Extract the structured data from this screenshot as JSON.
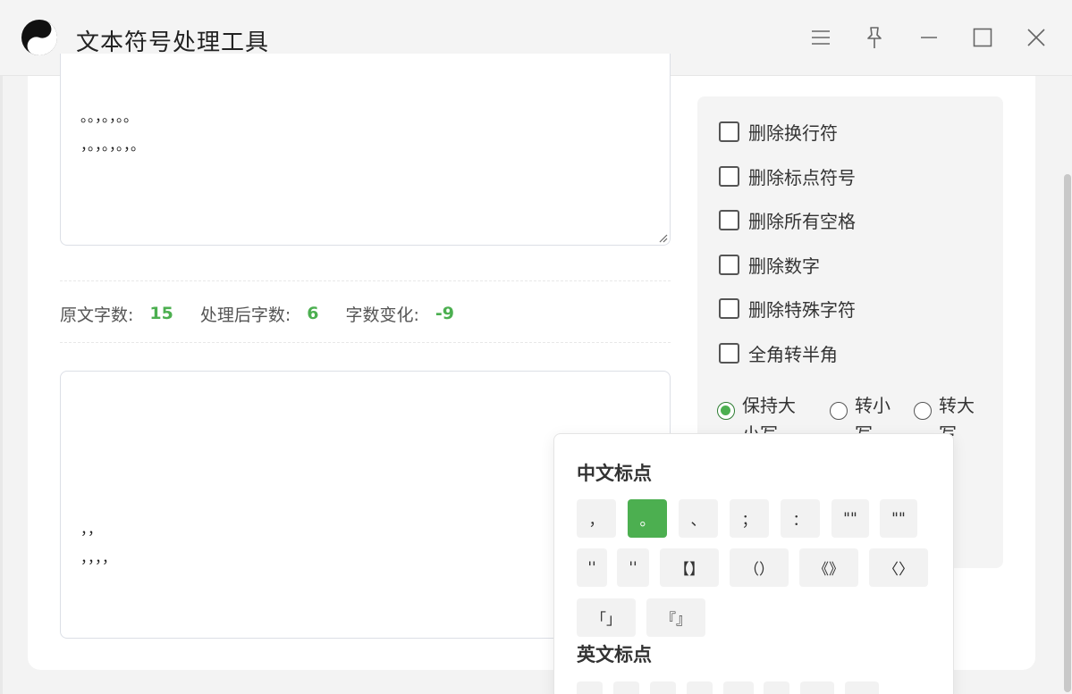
{
  "app": {
    "title": "文本符号处理工具"
  },
  "window_controls": [
    "menu-icon",
    "pin-icon",
    "minimize-icon",
    "maximize-icon",
    "close-icon"
  ],
  "input": {
    "lines": [
      "。。，。，。。",
      "，。，。，。，。"
    ]
  },
  "stats": {
    "original_label": "原文字数:",
    "original_value": "15",
    "processed_label": "处理后字数:",
    "processed_value": "6",
    "change_label": "字数变化:",
    "change_value": "-9"
  },
  "output": {
    "lines": [
      "，，",
      "，，，，"
    ]
  },
  "options": {
    "checkboxes": [
      {
        "label": "删除换行符",
        "checked": false
      },
      {
        "label": "删除标点符号",
        "checked": false
      },
      {
        "label": "删除所有空格",
        "checked": false
      },
      {
        "label": "删除数字",
        "checked": false
      },
      {
        "label": "删除特殊字符",
        "checked": false
      },
      {
        "label": "全角转半角",
        "checked": false
      }
    ],
    "case_radios": [
      {
        "label": "保持大小写",
        "checked": true
      },
      {
        "label": "转小写",
        "checked": false
      },
      {
        "label": "转大写",
        "checked": false
      }
    ]
  },
  "popover": {
    "chinese_heading": "中文标点",
    "chinese_chips": [
      "，",
      "。",
      "、",
      "；",
      "：",
      "\"\"",
      "\"\"",
      "''",
      "''",
      "【】",
      "（）",
      "《》",
      "〈〉",
      "「」",
      "『』"
    ],
    "active_chip": "。",
    "english_heading": "英文标点"
  },
  "colors": {
    "accent": "#4caf50",
    "panel_bg": "#f4f4f4"
  }
}
